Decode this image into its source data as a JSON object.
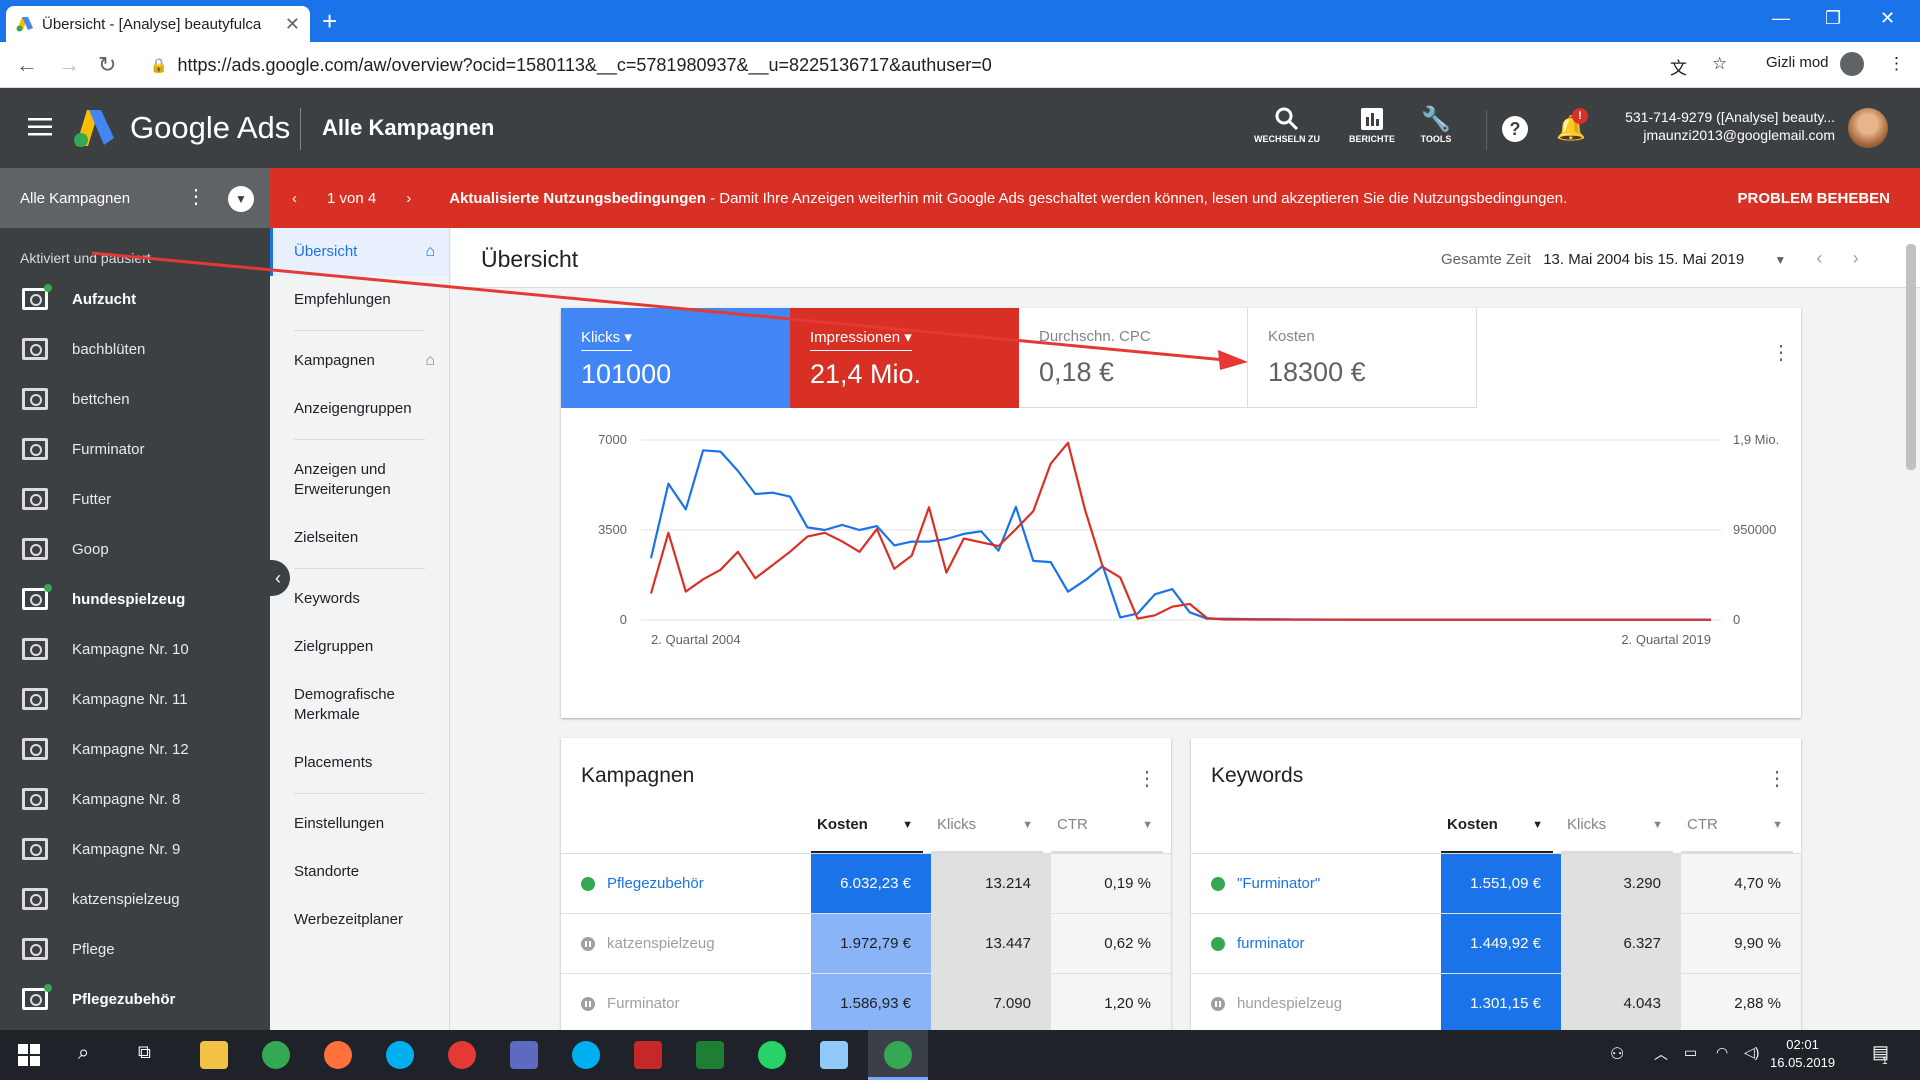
{
  "browser": {
    "tab_title": "Übersicht - [Analyse] beautyfulca",
    "url": "https://ads.google.com/aw/overview?ocid=1580113&__c=5781980937&__u=8225136717&authuser=0",
    "incognito_label": "Gizli mod"
  },
  "header": {
    "brand": "Google Ads",
    "page": "Alle Kampagnen",
    "buttons": {
      "search": "WECHSELN ZU",
      "reports": "BERICHTE",
      "tools": "TOOLS"
    },
    "account_line1": "531-714-9279 ([Analyse] beauty...",
    "account_line2": "jmaunzi2013@googlemail.com",
    "notification_badge": "!"
  },
  "sidebar": {
    "header": "Alle Kampagnen",
    "subheader": "Aktiviert und pausiert",
    "items": [
      {
        "label": "Aufzucht",
        "active": true
      },
      {
        "label": "bachblüten",
        "active": false
      },
      {
        "label": "bettchen",
        "active": false
      },
      {
        "label": "Furminator",
        "active": false
      },
      {
        "label": "Futter",
        "active": false
      },
      {
        "label": "Goop",
        "active": false
      },
      {
        "label": "hundespielzeug",
        "active": true
      },
      {
        "label": "Kampagne Nr. 10",
        "active": false
      },
      {
        "label": "Kampagne Nr. 11",
        "active": false
      },
      {
        "label": "Kampagne Nr. 12",
        "active": false
      },
      {
        "label": "Kampagne Nr. 8",
        "active": false
      },
      {
        "label": "Kampagne Nr. 9",
        "active": false
      },
      {
        "label": "katzenspielzeug",
        "active": false
      },
      {
        "label": "Pflege",
        "active": false
      },
      {
        "label": "Pflegezubehör",
        "active": true
      }
    ]
  },
  "banner": {
    "pager": "1 von 4",
    "title": "Aktualisierte Nutzungsbedingungen",
    "text": " - Damit Ihre Anzeigen weiterhin mit Google Ads geschaltet werden können, lesen und akzeptieren Sie die Nutzungsbedingungen.",
    "action": "PROBLEM BEHEBEN"
  },
  "pagenav": {
    "items": [
      "Übersicht",
      "Empfehlungen",
      "Kampagnen",
      "Anzeigengruppen",
      "Anzeigen und Erweiterungen",
      "Zielseiten",
      "Keywords",
      "Zielgruppen",
      "Demografische Merkmale",
      "Placements",
      "Einstellungen",
      "Standorte",
      "Werbezeitplaner"
    ]
  },
  "overview": {
    "title": "Übersicht",
    "range_label": "Gesamte Zeit",
    "range_value": "13. Mai 2004 bis 15. Mai 2019"
  },
  "metrics": [
    {
      "label": "Klicks",
      "value": "101000",
      "color": "#4285f4"
    },
    {
      "label": "Impressionen",
      "value": "21,4 Mio.",
      "color": "#d93025"
    },
    {
      "label": "Durchschn. CPC",
      "value": "0,18 €"
    },
    {
      "label": "Kosten",
      "value": "18300 €"
    }
  ],
  "chart_data": {
    "type": "line",
    "x_labels": [
      "2. Quartal 2004",
      "2. Quartal 2019"
    ],
    "y_left_ticks": [
      "7000",
      "3500",
      "0"
    ],
    "y_right_ticks": [
      "1,9 Mio.",
      "950000",
      "0"
    ],
    "ylim_left": [
      0,
      7000
    ],
    "ylim_right": [
      0,
      1900000
    ],
    "grid": true,
    "series": [
      {
        "name": "Klicks",
        "color": "#1a73e8",
        "axis": "left",
        "values": [
          2400,
          5300,
          4300,
          6600,
          6550,
          5800,
          4900,
          4950,
          4800,
          3600,
          3500,
          3700,
          3500,
          3650,
          2900,
          3050,
          3050,
          3150,
          3350,
          3450,
          2700,
          4400,
          2300,
          2250,
          1100,
          1550,
          2100,
          100,
          250,
          1000,
          1200,
          300,
          50,
          50,
          40,
          30,
          30,
          20,
          20,
          15,
          15,
          10,
          10,
          10,
          10,
          10,
          10,
          10,
          10,
          10,
          10,
          10,
          10,
          10,
          10,
          10,
          10,
          10,
          10,
          10,
          10,
          10
        ]
      },
      {
        "name": "Impressionen",
        "color": "#d93025",
        "axis": "right",
        "values": [
          280000,
          920000,
          300000,
          430000,
          530000,
          720000,
          440000,
          580000,
          720000,
          880000,
          920000,
          830000,
          720000,
          960000,
          540000,
          680000,
          1190000,
          500000,
          860000,
          820000,
          780000,
          960000,
          1150000,
          1650000,
          1870000,
          1150000,
          560000,
          450000,
          15000,
          50000,
          140000,
          170000,
          20000,
          5000,
          5000,
          4000,
          4000,
          3000,
          3000,
          3000,
          3000,
          2000,
          2000,
          2000,
          2000,
          2000,
          2000,
          2000,
          2000,
          2000,
          2000,
          2000,
          2000,
          2000,
          2000,
          2000,
          2000,
          2000,
          2000,
          2000,
          2000,
          2000
        ]
      }
    ]
  },
  "campaigns_table": {
    "title": "Kampagnen",
    "cols": [
      "Kosten",
      "Klicks",
      "CTR"
    ],
    "rows": [
      {
        "name": "Pflegezubehör",
        "status": "on",
        "cost": "6.032,23 €",
        "clicks": "13.214",
        "ctr": "0,19 %"
      },
      {
        "name": "katzenspielzeug",
        "status": "off",
        "cost": "1.972,79 €",
        "clicks": "13.447",
        "ctr": "0,62 %"
      },
      {
        "name": "Furminator",
        "status": "off",
        "cost": "1.586,93 €",
        "clicks": "7.090",
        "ctr": "1,20 %"
      }
    ]
  },
  "keywords_table": {
    "title": "Keywords",
    "cols": [
      "Kosten",
      "Klicks",
      "CTR"
    ],
    "rows": [
      {
        "name": "\"Furminator\"",
        "status": "on",
        "cost": "1.551,09 €",
        "clicks": "3.290",
        "ctr": "4,70 %"
      },
      {
        "name": "furminator",
        "status": "on",
        "cost": "1.449,92 €",
        "clicks": "6.327",
        "ctr": "9,90 %"
      },
      {
        "name": "hundespielzeug",
        "status": "off",
        "cost": "1.301,15 €",
        "clicks": "4.043",
        "ctr": "2,88 %"
      }
    ]
  },
  "taskbar": {
    "time": "02:01",
    "date": "16.05.2019",
    "notif": "1"
  }
}
